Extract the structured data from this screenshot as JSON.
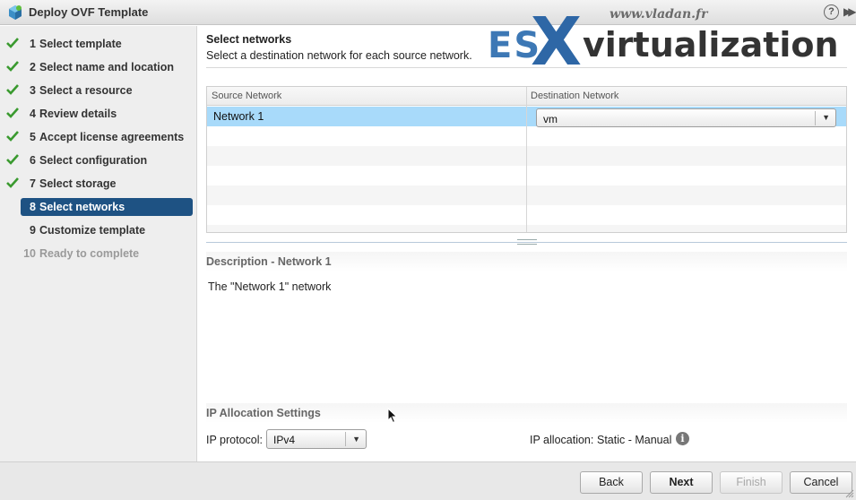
{
  "window": {
    "title": "Deploy OVF Template",
    "help_glyph": "?",
    "expand_glyph": "▶▶"
  },
  "watermark": {
    "url": "www.vladan.fr",
    "brand_es": "ES",
    "brand_x": "X",
    "brand_rest": "virtualization"
  },
  "steps": [
    {
      "num": "1",
      "label": "Select template",
      "state": "done"
    },
    {
      "num": "2",
      "label": "Select name and location",
      "state": "done"
    },
    {
      "num": "3",
      "label": "Select a resource",
      "state": "done"
    },
    {
      "num": "4",
      "label": "Review details",
      "state": "done"
    },
    {
      "num": "5",
      "label": "Accept license agreements",
      "state": "done"
    },
    {
      "num": "6",
      "label": "Select configuration",
      "state": "done"
    },
    {
      "num": "7",
      "label": "Select storage",
      "state": "done"
    },
    {
      "num": "8",
      "label": "Select networks",
      "state": "active"
    },
    {
      "num": "9",
      "label": "Customize template",
      "state": "pending"
    },
    {
      "num": "10",
      "label": "Ready to complete",
      "state": "disabled"
    }
  ],
  "main": {
    "title": "Select networks",
    "subtitle": "Select a destination network for each source network."
  },
  "grid": {
    "headers": [
      "Source Network",
      "Destination Network"
    ],
    "rows": [
      {
        "source": "Network 1",
        "destination": "vm"
      }
    ]
  },
  "description": {
    "title": "Description - Network 1",
    "text": "The \"Network 1\" network"
  },
  "ip": {
    "title": "IP Allocation Settings",
    "protocol_label": "IP protocol:",
    "protocol_value": "IPv4",
    "allocation_label": "IP allocation:",
    "allocation_value": "Static - Manual",
    "info_glyph": "i"
  },
  "footer": {
    "back": "Back",
    "next": "Next",
    "finish": "Finish",
    "cancel": "Cancel"
  },
  "colors": {
    "active_step": "#1e5283",
    "check": "#3a9a2f",
    "selected_row": "#a8dafa"
  }
}
